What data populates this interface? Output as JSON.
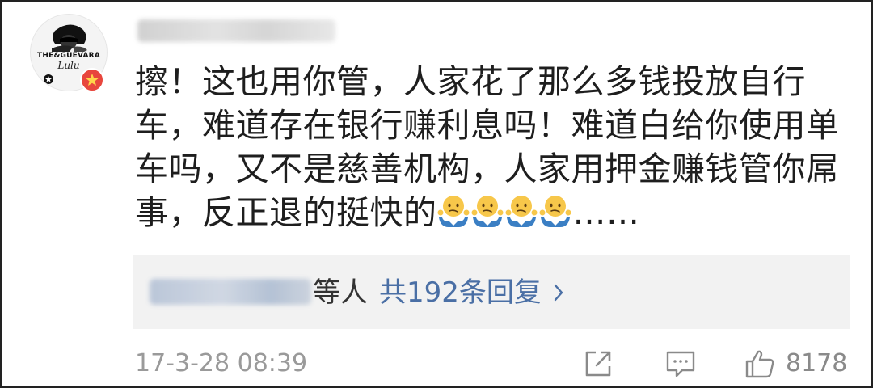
{
  "comment": {
    "avatar": {
      "brand_text": "THE&GUEVARA",
      "signature": "Lulu"
    },
    "lines": [
      "擦！这也用你管，人家花了那么多钱投放自行",
      "车，难道存在银行赚利息吗！难道白给你使用单",
      "车吗，又不是慈善机构，人家用押金赚钱管你屌",
      "事，反正退的挺快的"
    ],
    "emoji_count": 4,
    "emoji_name": "shrug-emoji",
    "trailing": "……",
    "replies": {
      "etc_label": "等人",
      "link_text": "共192条回复"
    },
    "timestamp": "17-3-28 08:39",
    "like_count": "8178"
  }
}
